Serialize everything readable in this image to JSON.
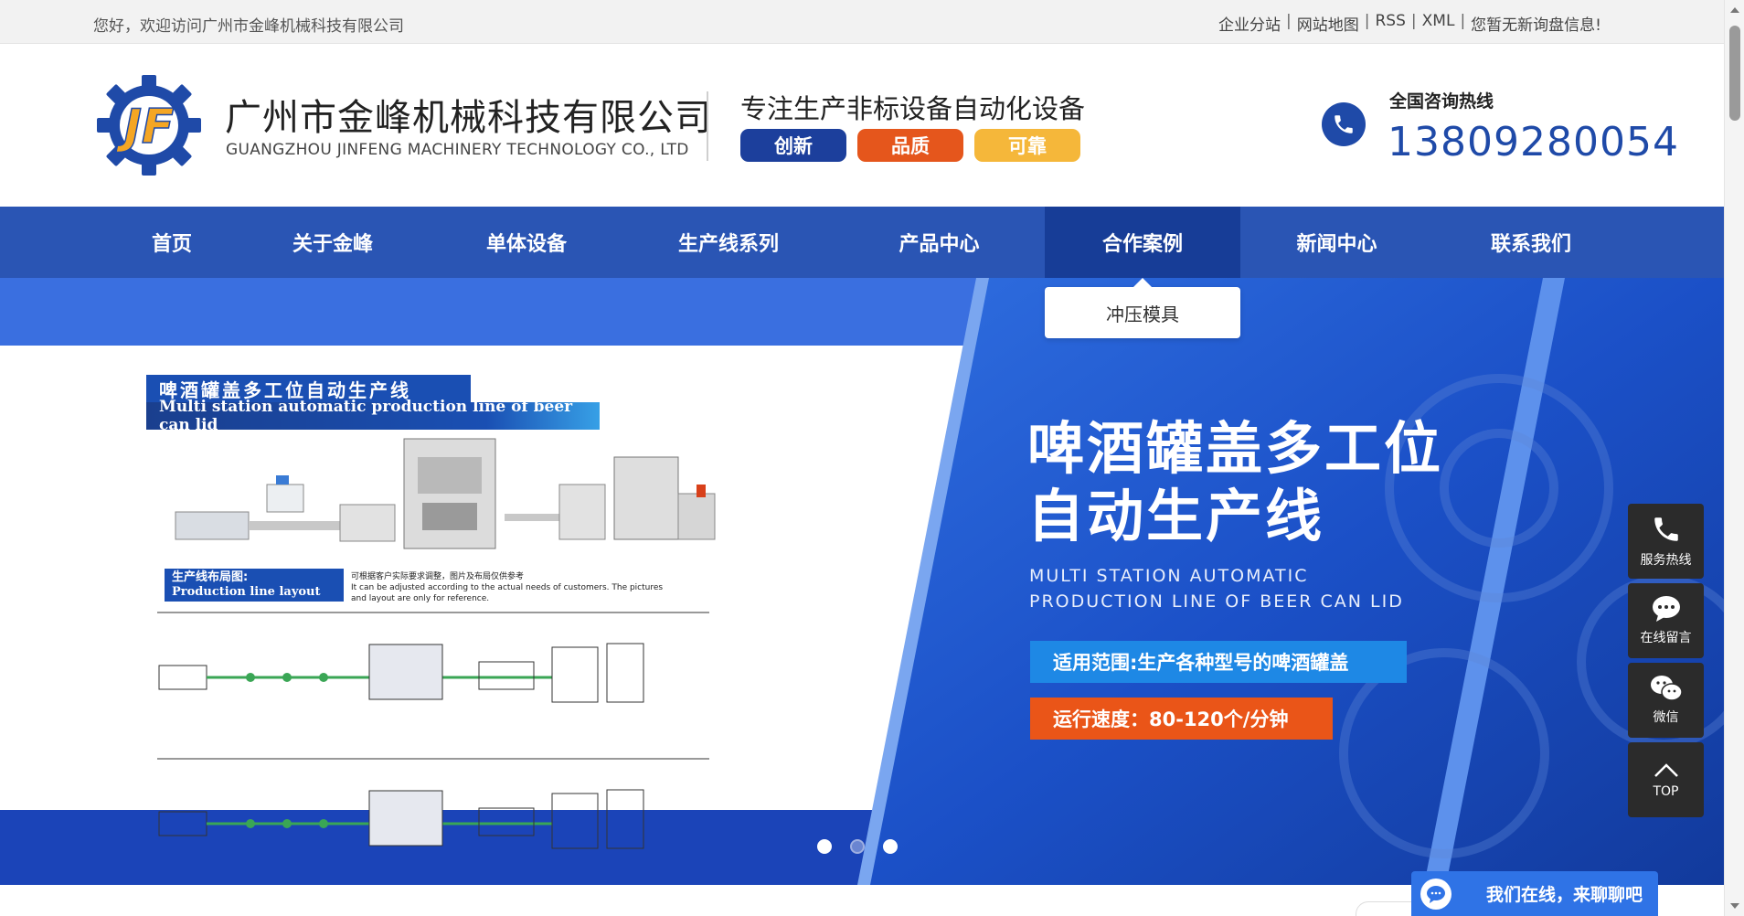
{
  "topbar": {
    "welcome": "您好，欢迎访问广州市金峰机械科技有限公司",
    "links": [
      "企业分站",
      "网站地图",
      "RSS",
      "XML",
      "您暂无新询盘信息!"
    ],
    "separator": "|"
  },
  "header": {
    "logo_text": "JF",
    "company_cn": "广州市金峰机械科技有限公司",
    "company_en": "GUANGZHOU JINFENG MACHINERY TECHNOLOGY CO., LTD",
    "slogan": "专注生产非标设备自动化设备",
    "badges": [
      "创新",
      "品质",
      "可靠"
    ],
    "hotline_label": "全国咨询热线",
    "hotline_number": "13809280054"
  },
  "nav": {
    "items": [
      "首页",
      "关于金峰",
      "单体设备",
      "生产线系列",
      "产品中心",
      "合作案例",
      "新闻中心",
      "联系我们"
    ],
    "active": "合作案例",
    "dropdown_item": "冲压模具"
  },
  "banner": {
    "tag_cn": "啤酒罐盖多工位自动生产线",
    "tag_en": "Multi station automatic production line of beer can lid",
    "layout_tag_cn": "生产线布局图:",
    "layout_tag_en": "Production line layout",
    "layout_note_cn": "可根据客户实际要求调整，图片及布局仅供参考",
    "layout_note_en": "It can be adjusted according to the actual needs of customers. The pictures and layout are only for reference.",
    "heading_line1": "啤酒罐盖多工位",
    "heading_line2": "自动生产线",
    "subtitle_en": "MULTI STATION AUTOMATIC PRODUCTION LINE OF BEER CAN LID",
    "range_text": "适用范围:生产各种型号的啤酒罐盖",
    "speed_text": "运行速度：80-120个/分钟",
    "slide_count": 3,
    "active_slide": 1
  },
  "floating": {
    "hotline": "服务热线",
    "message": "在线留言",
    "wechat": "微信",
    "top": "TOP"
  },
  "chat": {
    "text": "我们在线，来聊聊吧"
  },
  "colors": {
    "nav_blue": "#2a55b4",
    "nav_active": "#173d97",
    "brand_orange": "#e5561c",
    "brand_yellow": "#f5b73a",
    "hotline_blue": "#1f4aa8"
  },
  "icons": {
    "phone": "phone-icon",
    "chat": "chat-bubble-icon",
    "wechat": "wechat-icon",
    "top": "chevron-up-icon"
  }
}
